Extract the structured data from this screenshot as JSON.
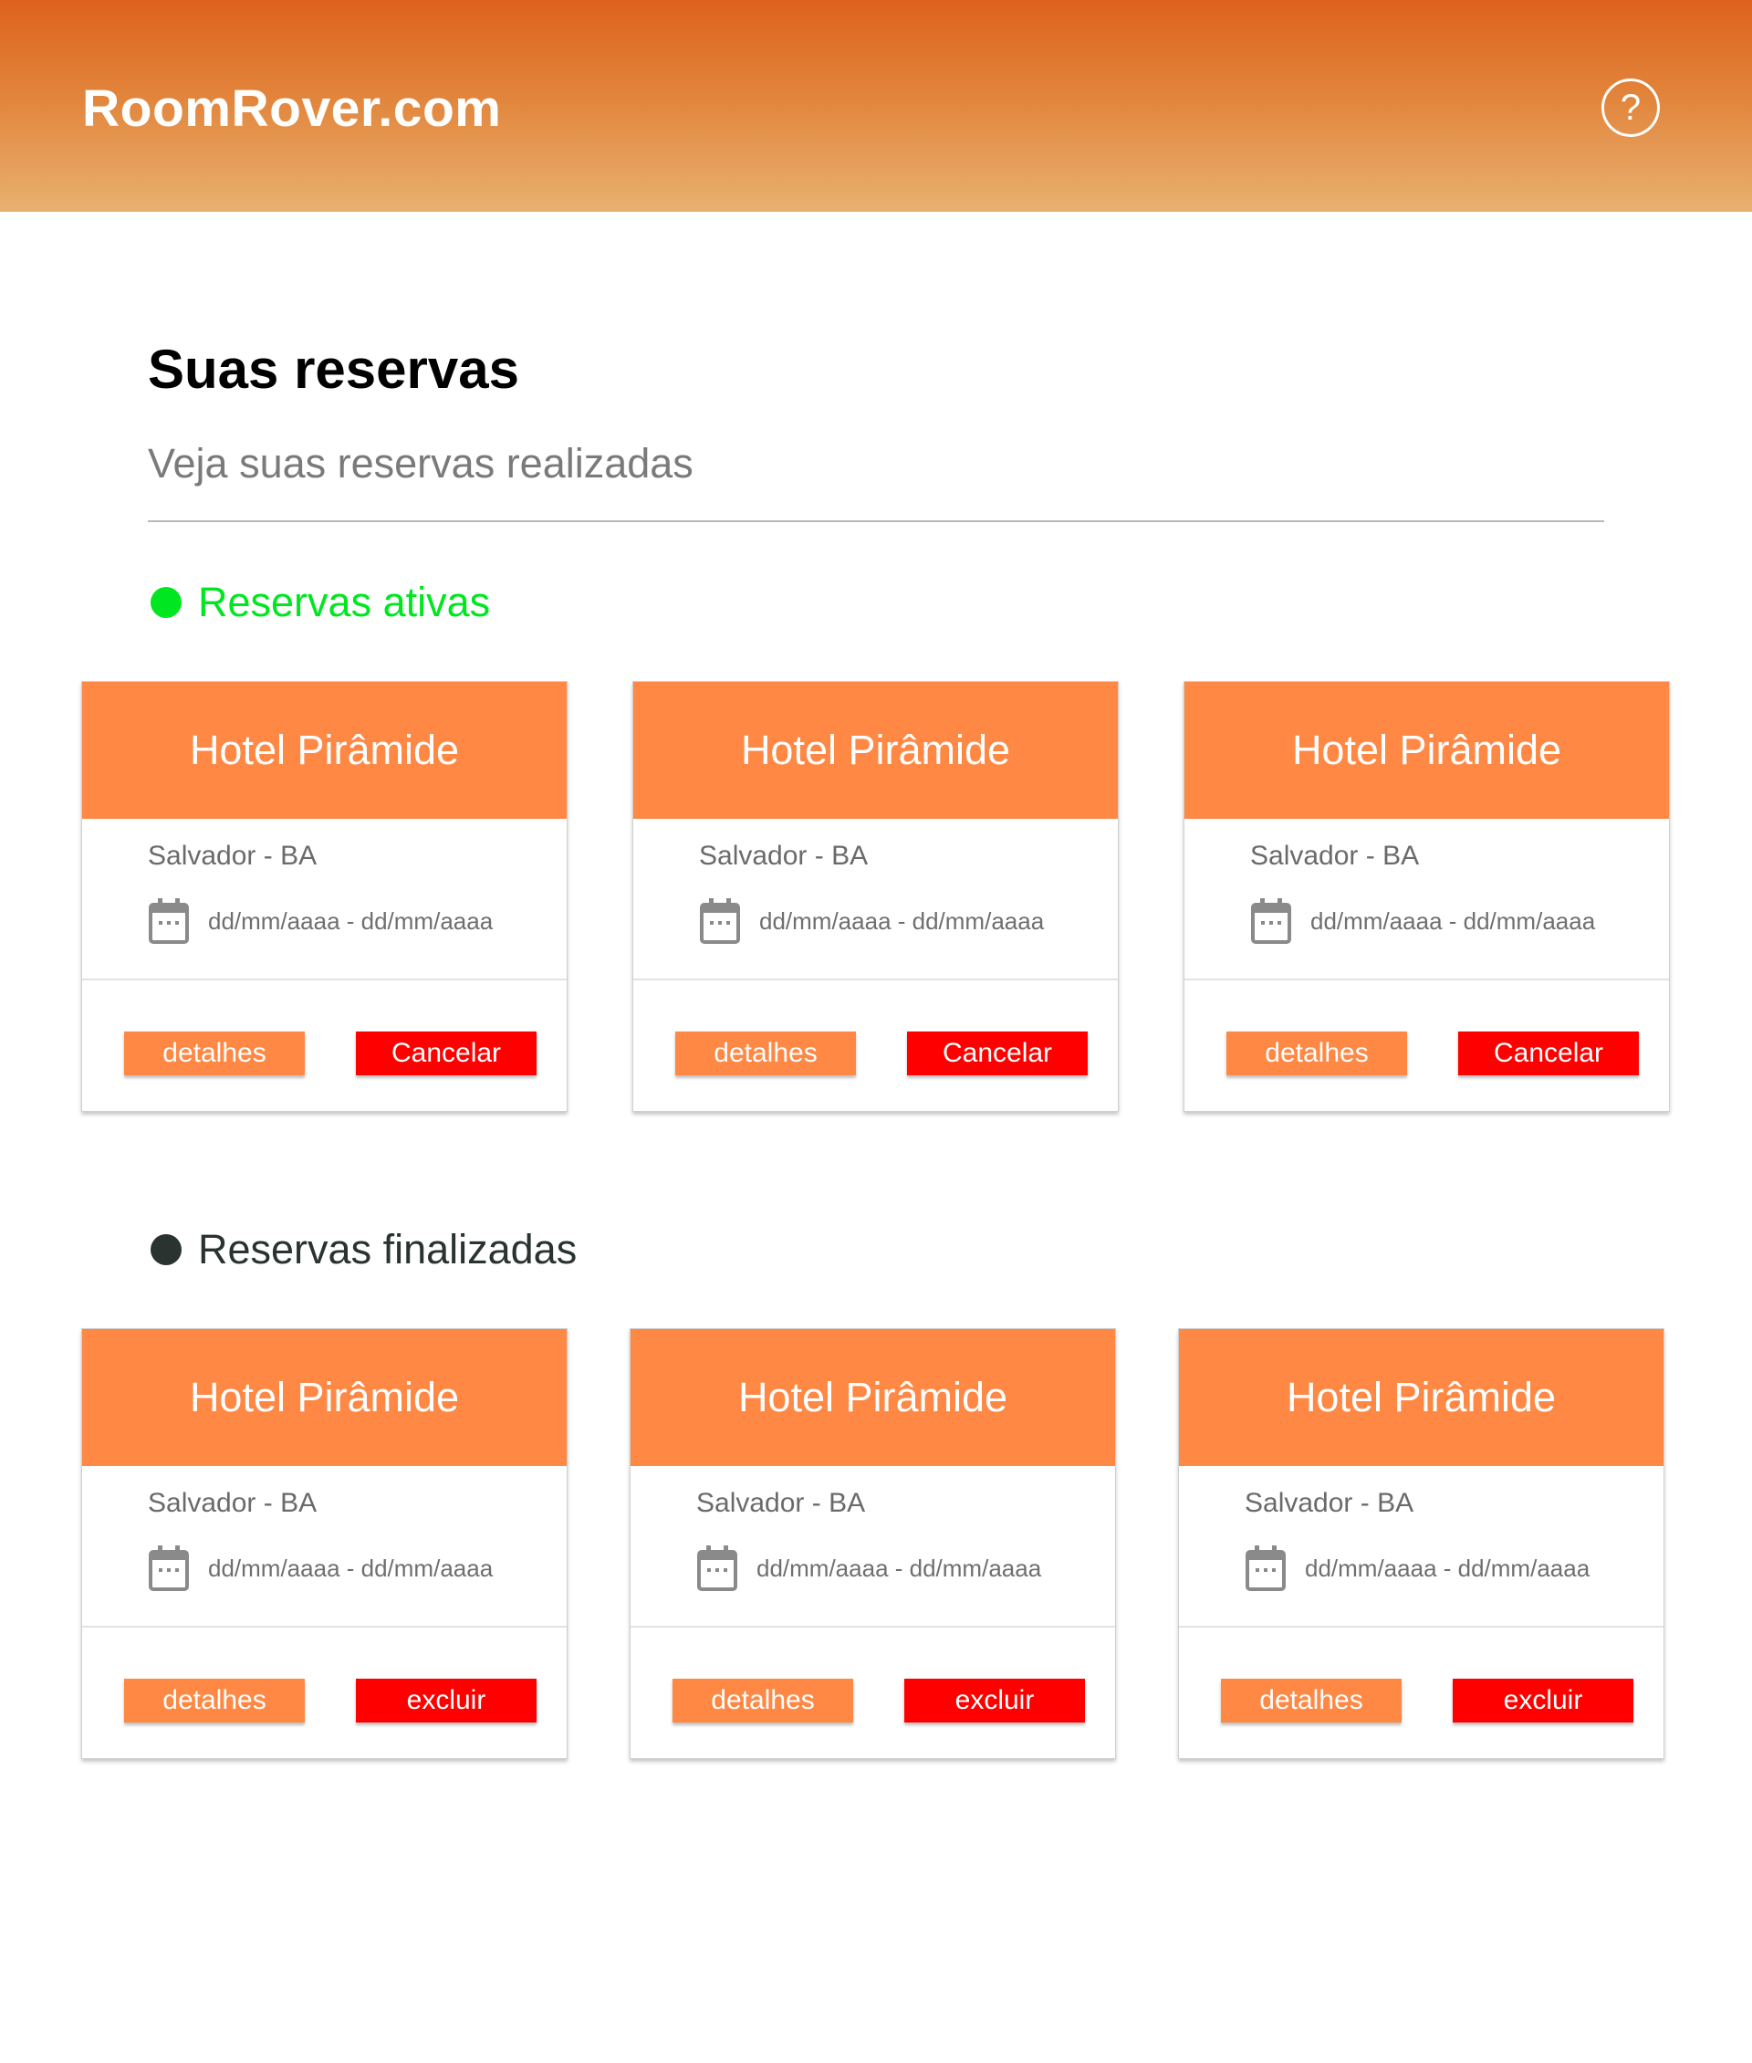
{
  "header": {
    "logo": "RoomRover.com",
    "help_icon": "question-circle-icon",
    "help_symbol": "?"
  },
  "page": {
    "title": "Suas reservas",
    "subtitle": "Veja suas reservas realizadas"
  },
  "colors": {
    "header_gradient_start": "#dd621c",
    "header_gradient_end": "#e8b170",
    "card_header": "#fe8844",
    "details_button": "#fe8844",
    "danger_button": "#ff0000",
    "active_status": "#00e620",
    "finished_status": "#2a332f"
  },
  "sections": {
    "active": {
      "heading": "Reservas ativas",
      "cards": [
        {
          "hotel": "Hotel Pirâmide",
          "location": "Salvador - BA",
          "dates": "dd/mm/aaaa - dd/mm/aaaa",
          "details_label": "detalhes",
          "action_label": "Cancelar"
        },
        {
          "hotel": "Hotel Pirâmide",
          "location": "Salvador - BA",
          "dates": "dd/mm/aaaa - dd/mm/aaaa",
          "details_label": "detalhes",
          "action_label": "Cancelar"
        },
        {
          "hotel": "Hotel Pirâmide",
          "location": "Salvador - BA",
          "dates": "dd/mm/aaaa - dd/mm/aaaa",
          "details_label": "detalhes",
          "action_label": "Cancelar"
        }
      ]
    },
    "finished": {
      "heading": "Reservas finalizadas",
      "cards": [
        {
          "hotel": "Hotel Pirâmide",
          "location": "Salvador - BA",
          "dates": "dd/mm/aaaa - dd/mm/aaaa",
          "details_label": "detalhes",
          "action_label": "excluir"
        },
        {
          "hotel": "Hotel Pirâmide",
          "location": "Salvador - BA",
          "dates": "dd/mm/aaaa - dd/mm/aaaa",
          "details_label": "detalhes",
          "action_label": "excluir"
        },
        {
          "hotel": "Hotel Pirâmide",
          "location": "Salvador - BA",
          "dates": "dd/mm/aaaa - dd/mm/aaaa",
          "details_label": "detalhes",
          "action_label": "excluir"
        }
      ]
    }
  }
}
